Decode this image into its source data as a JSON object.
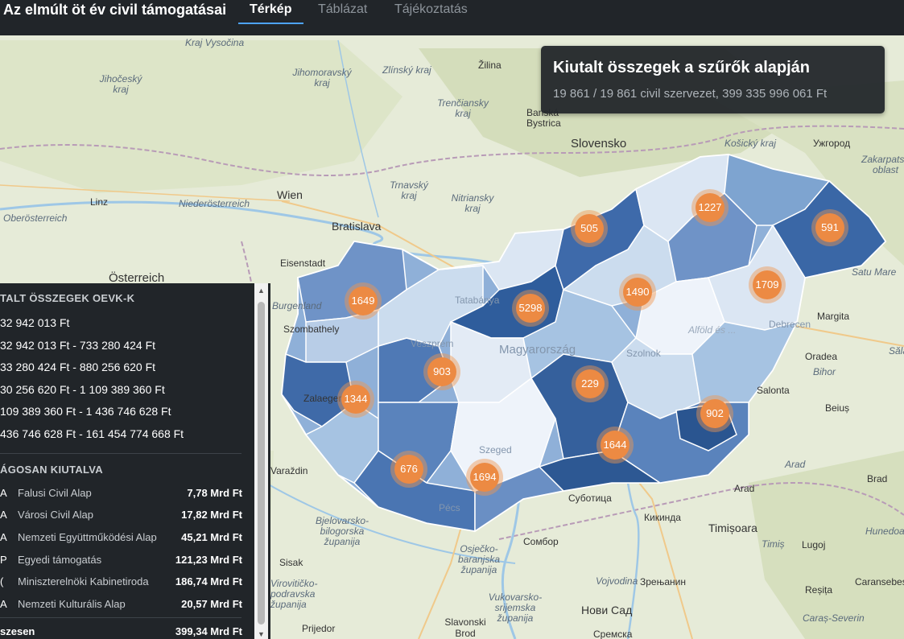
{
  "header": {
    "title": "Az elmúlt öt év civil támogatásai",
    "tabs": [
      {
        "label": "Térkép",
        "active": true
      },
      {
        "label": "Táblázat",
        "active": false
      },
      {
        "label": "Tájékoztatás",
        "active": false
      }
    ]
  },
  "info": {
    "title": "Kiutalt összegek a szűrők alapján",
    "subtitle": "19 861 / 19 861 civil szervezet, 399 335 996 061 Ft"
  },
  "legend": {
    "ranges_title": "TALT ÖSSZEGEK OEVK-K",
    "ranges": [
      "32 942 013 Ft",
      "32 942 013 Ft - 733 280 424 Ft",
      "33 280 424 Ft - 880 256 620 Ft",
      "30 256 620 Ft - 1 109 389 360 Ft",
      "109 389 360 Ft - 1 436 746 628 Ft",
      "436 746 628 Ft - 161 454 774 668 Ft"
    ],
    "range_colors": [
      "#eef3fa",
      "#cbdcee",
      "#a6c3e2",
      "#7ea4d0",
      "#5a83bc",
      "#35609c"
    ],
    "funds_title": "ÁGOSAN KIUTALVA",
    "funds": [
      {
        "code": "A",
        "name": "Falusi Civil Alap",
        "amount": "7,78 Mrd Ft"
      },
      {
        "code": "A",
        "name": "Városi Civil Alap",
        "amount": "17,82 Mrd Ft"
      },
      {
        "code": "A",
        "name": "Nemzeti Együttműködési Alap",
        "amount": "45,21 Mrd Ft"
      },
      {
        "code": "P",
        "name": "Egyedi támogatás",
        "amount": "121,23 Mrd Ft"
      },
      {
        "code": "(",
        "name": "Miniszterelnöki Kabinetiroda",
        "amount": "186,74 Mrd Ft"
      },
      {
        "code": "A",
        "name": "Nemzeti Kulturális Alap",
        "amount": "20,57 Mrd Ft"
      }
    ],
    "total_label": "szesen",
    "total_amount": "399,34 Mrd Ft"
  },
  "clusters": [
    {
      "label": "505"
    },
    {
      "label": "1227"
    },
    {
      "label": "591"
    },
    {
      "label": "1649"
    },
    {
      "label": "5298"
    },
    {
      "label": "1490"
    },
    {
      "label": "1709"
    },
    {
      "label": "903"
    },
    {
      "label": "229"
    },
    {
      "label": "1344"
    },
    {
      "label": "902"
    },
    {
      "label": "1644"
    },
    {
      "label": "676"
    },
    {
      "label": "1694"
    }
  ],
  "map_labels": {
    "regions": [
      "Kraj Vysočina",
      "Jihomoravský kraj",
      "Zlínský kraj",
      "Jihočeský kraj",
      "Trenčiansky kraj",
      "Trnavský kraj",
      "Nitriansky kraj",
      "Niederösterreich",
      "Oberösterreich",
      "Burgenland",
      "Bjelovarsko-bilogorska županija",
      "Osječko-baranjska županija",
      "Vukovarsko-srijemska županija",
      "Virovitičko-podravska županija",
      "Košický kraj",
      "Zakarpatska oblast",
      "Satu Mare",
      "Bihor",
      "Arad",
      "Timiș",
      "Hunedoara",
      "Caraș-Severin",
      "Vojvodina",
      "Alföld és ...",
      "Sălaj"
    ],
    "cities": [
      "Žilina",
      "Banská Bystrica",
      "Wien",
      "Linz",
      "Eisenstadt",
      "Szombathely",
      "Zalaegerszeg",
      "Varaždin",
      "Sisak",
      "Prijedor",
      "Slavonski Brod",
      "Сомбор",
      "Кикинда",
      "Зрењанин",
      "Нови Сад",
      "Сремска",
      "Суботица",
      "Arad",
      "Timișoara",
      "Lugoj",
      "Reșița",
      "Caransebeș",
      "Margita",
      "Oradea",
      "Salonta",
      "Beiuș",
      "Brad",
      "Ужгород",
      "Tatabánya",
      "Pécs",
      "Szeged",
      "Szolnok",
      "Veszprém",
      "Debrecen"
    ],
    "countries": [
      "Slovensko",
      "Bratislava",
      "Österreich",
      "Magyarország"
    ]
  }
}
